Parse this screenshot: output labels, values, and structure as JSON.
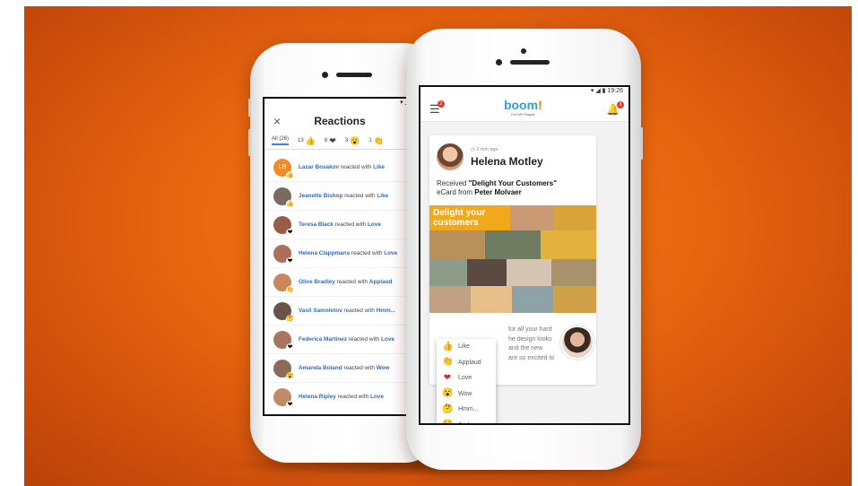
{
  "reactions_screen": {
    "title": "Reactions",
    "close_icon": "×",
    "tabs": [
      {
        "label": "All (26)",
        "icon": ""
      },
      {
        "label": "13",
        "icon": "👍"
      },
      {
        "label": "8",
        "icon": "❤"
      },
      {
        "label": "3",
        "icon": "😮"
      },
      {
        "label": "1",
        "icon": "👏"
      }
    ],
    "items": [
      {
        "name": "Lazar Bosakov",
        "verb": "reacted with",
        "reaction": "Like",
        "initials": "LB",
        "avatar_color": "#f08a2a",
        "badge": "👍"
      },
      {
        "name": "Jeanette Bishop",
        "verb": "reacted with",
        "reaction": "Like",
        "initials": "",
        "avatar_color": "#7b6b5e",
        "badge": "👍"
      },
      {
        "name": "Teresa Black",
        "verb": "reacted with",
        "reaction": "Love",
        "initials": "",
        "avatar_color": "#9c5a48",
        "badge": "❤"
      },
      {
        "name": "Helena Clappmans",
        "verb": "reacted with",
        "reaction": "Love",
        "initials": "",
        "avatar_color": "#b06e58",
        "badge": "❤"
      },
      {
        "name": "Olive Bradley",
        "verb": "reacted with",
        "reaction": "Applaud",
        "initials": "",
        "avatar_color": "#c9885a",
        "badge": "👏"
      },
      {
        "name": "Vasil Samoletov",
        "verb": "reacted with",
        "reaction": "Hmm...",
        "initials": "",
        "avatar_color": "#6a5448",
        "badge": "🤔"
      },
      {
        "name": "Federica Martinez",
        "verb": "reacted with",
        "reaction": "Love",
        "initials": "",
        "avatar_color": "#a8765e",
        "badge": "❤"
      },
      {
        "name": "Amanda Boland",
        "verb": "reacted with",
        "reaction": "Wow",
        "initials": "",
        "avatar_color": "#8a6a58",
        "badge": "😮"
      },
      {
        "name": "Helena Ripley",
        "verb": "reacted with",
        "reaction": "Love",
        "initials": "",
        "avatar_color": "#c08a68",
        "badge": "❤"
      }
    ]
  },
  "boom_screen": {
    "status_time": "19:26",
    "logo": "boom",
    "logo_exclaim": "!",
    "logo_sub": "For HR People",
    "menu_badge": "2",
    "notif_badge": "3",
    "card": {
      "time": "2 min ago",
      "name": "Helena Motley",
      "desc_prefix": "Received ",
      "ecard_title": "\"Delight Your Customers\"",
      "desc_mid": "eCard  from ",
      "sender": "Peter Molvaer",
      "banner": "Delight your customers",
      "message_lines": [
        "for all your hard",
        "he design looks",
        "and the new",
        "are so excited to"
      ]
    },
    "reaction_menu": [
      {
        "label": "Like",
        "icon": "👍",
        "color": "#f2b51a"
      },
      {
        "label": "Applaud",
        "icon": "👏",
        "color": "#f2b51a"
      },
      {
        "label": "Love",
        "icon": "❤",
        "color": "#e0282a"
      },
      {
        "label": "Wow",
        "icon": "😮",
        "color": "#f2b51a"
      },
      {
        "label": "Hmm...",
        "icon": "🤔",
        "color": "#f2b51a"
      },
      {
        "label": "Sad",
        "icon": "😟",
        "color": "#f2b51a"
      }
    ]
  },
  "colors": {
    "background": "#e8650f",
    "link": "#2a6ec6",
    "accent": "#f2a81a"
  }
}
